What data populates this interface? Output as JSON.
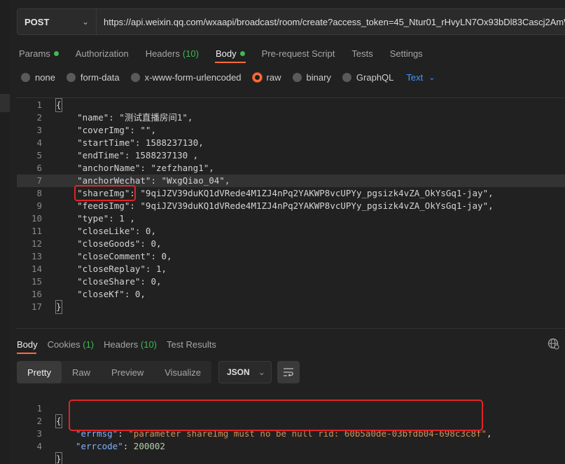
{
  "request": {
    "method": "POST",
    "url": "https://api.weixin.qq.com/wxaapi/broadcast/room/create?access_token=45_Ntur01_rHvyLN7Ox93bDl83Cascj2AmW"
  },
  "req_tabs": {
    "params": "Params",
    "authorization": "Authorization",
    "headers": "Headers",
    "headers_count": "(10)",
    "body": "Body",
    "prerequest": "Pre-request Script",
    "tests": "Tests",
    "settings": "Settings"
  },
  "body_types": {
    "none": "none",
    "form_data": "form-data",
    "urlencoded": "x-www-form-urlencoded",
    "raw": "raw",
    "binary": "binary",
    "graphql": "GraphQL",
    "text_format": "Text"
  },
  "request_body_lines": [
    {
      "n": "1",
      "code": "{"
    },
    {
      "n": "2",
      "code": "    \"name\": \"测试直播房间1\","
    },
    {
      "n": "3",
      "code": "    \"coverImg\": \"\","
    },
    {
      "n": "4",
      "code": "    \"startTime\": 1588237130,"
    },
    {
      "n": "5",
      "code": "    \"endTime\": 1588237130 ,"
    },
    {
      "n": "6",
      "code": "    \"anchorName\": \"zefzhang1\","
    },
    {
      "n": "7",
      "code": "    \"anchorWechat\": \"WxgQiao_04\","
    },
    {
      "n": "8",
      "code": "    \"shareImg\": \"9qiJZV39duKQ1dVRede4M1ZJ4nPq2YAKWP8vcUPYy_pgsizk4vZA_OkYsGq1-jay\","
    },
    {
      "n": "9",
      "code": "    \"feedsImg\": \"9qiJZV39duKQ1dVRede4M1ZJ4nPq2YAKWP8vcUPYy_pgsizk4vZA_OkYsGq1-jay\","
    },
    {
      "n": "10",
      "code": "    \"type\": 1 ,"
    },
    {
      "n": "11",
      "code": "    \"closeLike\": 0,"
    },
    {
      "n": "12",
      "code": "    \"closeGoods\": 0,"
    },
    {
      "n": "13",
      "code": "    \"closeComment\": 0,"
    },
    {
      "n": "14",
      "code": "    \"closeReplay\": 1,"
    },
    {
      "n": "15",
      "code": "    \"closeShare\": 0,"
    },
    {
      "n": "16",
      "code": "    \"closeKf\": 0,"
    },
    {
      "n": "17",
      "code": "}"
    }
  ],
  "resp_tabs": {
    "body": "Body",
    "cookies": "Cookies",
    "cookies_count": "(1)",
    "headers": "Headers",
    "headers_count": "(10)",
    "test_results": "Test Results"
  },
  "view_tabs": {
    "pretty": "Pretty",
    "raw": "Raw",
    "preview": "Preview",
    "visualize": "Visualize"
  },
  "format_select": "JSON",
  "response": {
    "open": "{",
    "errmsg_key": "\"errmsg\"",
    "errmsg_value": "\"parameter shareImg must no be null rid: 60b5a0de-03bfdb04-698c3c8f\"",
    "errcode_key": "\"errcode\"",
    "errcode_value": "200002",
    "close": "}",
    "line_numbers": [
      "1",
      "2",
      "3",
      "4"
    ]
  },
  "colors": {
    "accent": "#ff6c37",
    "green": "#3fb950",
    "link": "#3b9cff",
    "highlight_red": "#e02424"
  }
}
